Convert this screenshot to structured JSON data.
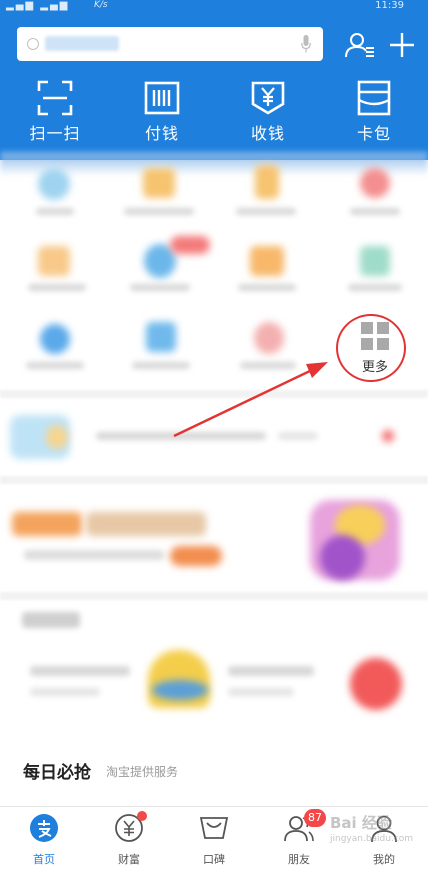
{
  "statusbar": {
    "signal": "▂▄▆ ▂▄▆",
    "rate": "K/s",
    "time": "11:39"
  },
  "header": {
    "quick_actions": [
      {
        "label": "扫一扫",
        "icon": "scan-icon"
      },
      {
        "label": "付钱",
        "icon": "barcode-pay-icon"
      },
      {
        "label": "收钱",
        "icon": "yuan-receive-icon"
      },
      {
        "label": "卡包",
        "icon": "card-wallet-icon"
      }
    ]
  },
  "apps": {
    "more_label": "更多"
  },
  "sections": {
    "daily_title": "每日必抢",
    "daily_subtitle": "淘宝提供服务"
  },
  "tabbar": {
    "tabs": [
      {
        "label": "首页",
        "icon": "alipay-home-icon",
        "active": true
      },
      {
        "label": "财富",
        "icon": "wealth-yuan-icon"
      },
      {
        "label": "口碑",
        "icon": "koubei-smile-icon"
      },
      {
        "label": "朋友",
        "icon": "friends-icon",
        "badge": "87"
      },
      {
        "label": "我的",
        "icon": "profile-icon"
      }
    ]
  },
  "watermark": {
    "text": "Bai 经验",
    "sub": "jingyan.baidu.com"
  },
  "colors": {
    "brand_blue": "#1f7fdc",
    "badge_red": "#f24848",
    "annotation_red": "#e23434"
  }
}
